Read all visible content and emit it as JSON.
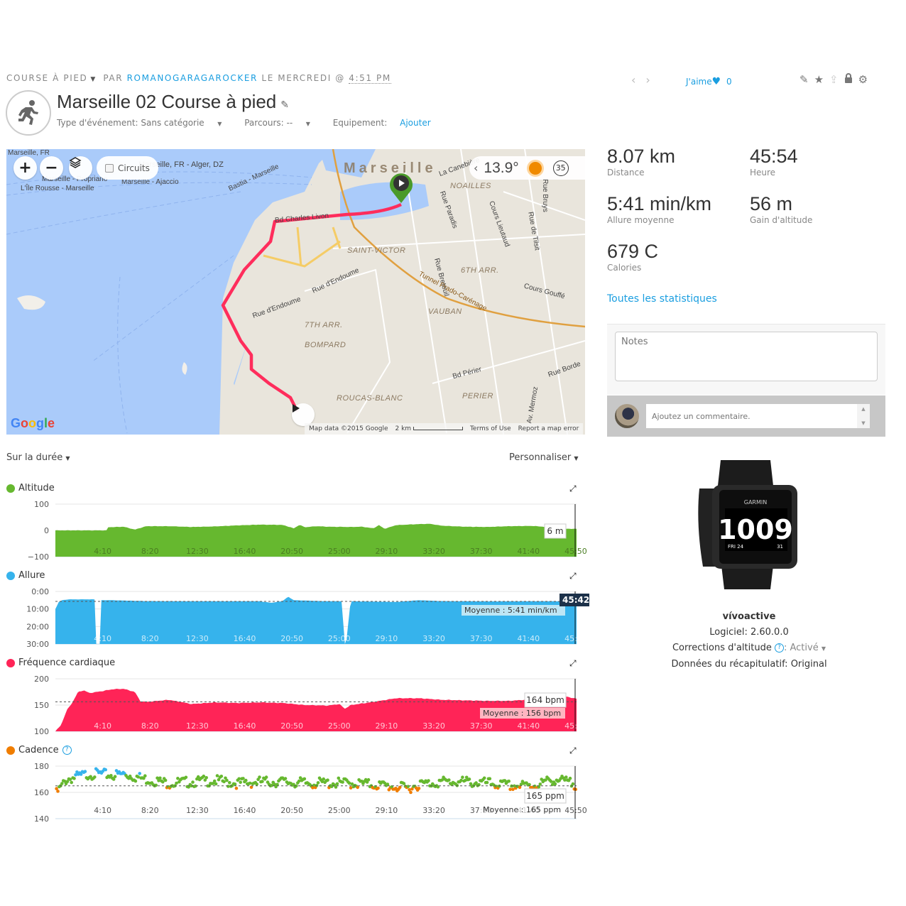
{
  "header": {
    "activity_type": "COURSE À PIED",
    "by_label": "PAR",
    "user": "ROMANOGARAGAROCKER",
    "day_label": "LE MERCREDI @",
    "time": "4:51 PM",
    "title": "Marseille 02 Course à pied",
    "event_type_label": "Type d'événement: Sans catégorie",
    "course_label": "Parcours: --",
    "equipment_label": "Equipement:",
    "equipment_link": "Ajouter",
    "like_label": "J'aime",
    "like_count": "0",
    "icons": [
      "prev-arrow-icon",
      "next-arrow-icon",
      "pencil-icon",
      "star-icon",
      "share-icon",
      "lock-icon",
      "gear-icon"
    ]
  },
  "map": {
    "circuits_label": "Circuits",
    "temperature": "13.9°",
    "wind": "35",
    "labels": {
      "city": "Marseille",
      "ferry1": "Marseille, FR",
      "ferry2": "Marseille, FR - Alger, DZ",
      "ferry3": "Marseille - Propriano",
      "ferry4": "L'Île Rousse - Marseille",
      "ferry5": "Marseille - Ajaccio",
      "ferry6": "Bastia - Marseille",
      "canebiere": "La Canebière",
      "noailles": "NOAILLES",
      "brys": "Rue Bruys",
      "paradis": "Rue Paradis",
      "lieutaud": "Cours Lieutaud",
      "tilsit": "Rue de Tilsit",
      "livon": "Bd Charles Livon",
      "saint_victor": "SAINT-VICTOR",
      "breteuil": "Rue Breteuil",
      "arr6": "6TH ARR.",
      "endoume1": "Rue d'Endoume",
      "endoume2": "Rue d'Endoume",
      "gouffe": "Cours Gouffé",
      "tunnel": "Tunnel Prado-Carénage",
      "vauban": "VAUBAN",
      "arr7": "7TH ARR.",
      "bompard": "BOMPARD",
      "perier_bd": "Bd Périer",
      "rue_borde": "Rue Borde",
      "roucas": "ROUCAS-BLANC",
      "perier": "PERIER",
      "mermoz": "Av. Mermoz"
    },
    "footer": {
      "data": "Map data ©2015 Google",
      "scale": "2 km",
      "terms": "Terms of Use",
      "report": "Report a map error"
    },
    "google": "Google"
  },
  "stats": [
    {
      "value": "8.07 km",
      "label": "Distance"
    },
    {
      "value": "45:54",
      "label": "Heure"
    },
    {
      "value": "5:41 min/km",
      "label": "Allure moyenne"
    },
    {
      "value": "56 m",
      "label": "Gain d'altitude"
    },
    {
      "value": "679 C",
      "label": "Calories"
    }
  ],
  "all_stats_link": "Toutes les statistiques",
  "notes_placeholder": "Notes",
  "comment_placeholder": "Ajoutez un commentaire.",
  "device": {
    "name": "vívoactive",
    "software": "Logiciel: 2.60.0.0",
    "altitude_corr_label": "Corrections d'altitude",
    "altitude_corr_value": ": Activé",
    "summary_data": "Données du récapitulatif: Original",
    "watch_brand": "GARMIN",
    "watch_time": "1009",
    "watch_date": "FRI 24",
    "watch_sec": "31"
  },
  "chart_controls": {
    "x_mode": "Sur la durée",
    "customize": "Personnaliser"
  },
  "chart_data": [
    {
      "type": "area",
      "title": "Altitude",
      "color": "#66b82f",
      "xlabel": "",
      "ylabel": "m",
      "x_ticks": [
        "4:10",
        "8:20",
        "12:30",
        "16:40",
        "20:50",
        "25:00",
        "29:10",
        "33:20",
        "37:30",
        "41:40",
        "45:50"
      ],
      "y_ticks": [
        "100",
        "0",
        "−100"
      ],
      "ylim": [
        -100,
        100
      ],
      "xlim_min": [
        0,
        45.9
      ],
      "x_min": [
        0,
        4.5,
        4.6,
        6,
        7,
        8,
        10,
        12,
        14,
        16,
        18,
        20,
        21,
        21.5,
        22,
        23,
        24,
        26,
        27,
        28,
        28.5,
        29,
        30,
        32,
        33,
        34,
        36,
        38,
        40,
        42,
        43,
        44,
        45.9
      ],
      "values": [
        0,
        0,
        12,
        14,
        3,
        16,
        16,
        13,
        15,
        19,
        22,
        21,
        8,
        21,
        12,
        16,
        14,
        13,
        14,
        8,
        20,
        6,
        20,
        24,
        25,
        18,
        14,
        13,
        16,
        17,
        14,
        6,
        6
      ],
      "tooltip": "6 m"
    },
    {
      "type": "area",
      "title": "Allure",
      "color": "#36b3ec",
      "ylabel": "min/km",
      "y_ticks": [
        "0:00",
        "10:00",
        "20:00",
        "30:00"
      ],
      "ylim_inverted": [
        0,
        30
      ],
      "x_ticks": [
        "4:10",
        "8:20",
        "12:30",
        "16:40",
        "20:50",
        "25:00",
        "29:10",
        "33:20",
        "37:30",
        "41:40",
        "45:50"
      ],
      "x_min": [
        0,
        0.3,
        0.6,
        1.2,
        2,
        3,
        3.5,
        3.6,
        3.9,
        4,
        5,
        8,
        12,
        16,
        18,
        19,
        20,
        20.5,
        21,
        24,
        25.3,
        25.4,
        25.6,
        26,
        28,
        30,
        32,
        34,
        38,
        42,
        45.9
      ],
      "values": [
        10,
        6,
        5,
        4.5,
        4.5,
        4.5,
        4.5,
        30,
        30,
        5,
        5,
        5.5,
        5.6,
        5.6,
        5.6,
        6.5,
        5.5,
        3,
        5,
        5.6,
        5.6,
        30,
        30,
        5.6,
        5.8,
        6,
        5,
        5.5,
        5.7,
        5.6,
        5.6
      ],
      "average_label": "Moyenne : 5:41 min/km",
      "average": 5.68,
      "cursor_label": "45:42"
    },
    {
      "type": "area",
      "title": "Fréquence cardiaque",
      "color": "#ff2457",
      "ylabel": "bpm",
      "y_ticks": [
        "200",
        "150",
        "100"
      ],
      "ylim": [
        100,
        200
      ],
      "x_ticks": [
        "4:10",
        "8:20",
        "12:30",
        "16:40",
        "20:50",
        "25:00",
        "29:10",
        "33:20",
        "37:30",
        "41:40",
        "45:50"
      ],
      "x_min": [
        0,
        0.5,
        1,
        1.5,
        2,
        2.5,
        3,
        4,
        5,
        6,
        7,
        7.5,
        8,
        10,
        12,
        14,
        16,
        18,
        20,
        22,
        24,
        25,
        25.5,
        26,
        28,
        30,
        32,
        34,
        36,
        38,
        40,
        42,
        44,
        45,
        45.9
      ],
      "values": [
        100,
        112,
        140,
        155,
        175,
        178,
        173,
        176,
        180,
        181,
        175,
        157,
        156,
        160,
        152,
        155,
        154,
        155,
        154,
        150,
        149,
        152,
        143,
        150,
        156,
        163,
        163,
        160,
        159,
        158,
        158,
        161,
        158,
        166,
        162
      ],
      "average_label": "Moyenne : 156 bpm",
      "average": 156,
      "tooltip": "164 bpm"
    },
    {
      "type": "scatter",
      "title": "Cadence",
      "color": "#f07d00",
      "ylabel": "ppm",
      "y_ticks": [
        "180",
        "160",
        "140"
      ],
      "ylim": [
        140,
        180
      ],
      "x_ticks": [
        "4:10",
        "8:20",
        "12:30",
        "16:40",
        "20:50",
        "25:00",
        "29:10",
        "33:20",
        "37:30",
        "41:40",
        "45:50"
      ],
      "zone_colors": {
        "high": "#36b3ec",
        "mid": "#66b82f",
        "low": "#f07d00"
      },
      "zone_thresholds": {
        "high_above": 173,
        "low_below": 164
      },
      "sample_every_min": 0.12,
      "trend_min": [
        0,
        0.5,
        1,
        2,
        3,
        4,
        5,
        6,
        7,
        8,
        10,
        12,
        14,
        16,
        18,
        20,
        22,
        24,
        26,
        28,
        30,
        31,
        32,
        34,
        36,
        38,
        40,
        42,
        44,
        45.9
      ],
      "trend_values": [
        158,
        164,
        170,
        172,
        174,
        174,
        173,
        174,
        172,
        170,
        167,
        168,
        169,
        167,
        168,
        168,
        167,
        167,
        167,
        166,
        164,
        163,
        166,
        168,
        168,
        167,
        165,
        165,
        170,
        166
      ],
      "average_label": "Moyenne : 165 ppm",
      "average": 165,
      "tooltip": "165 ppm"
    }
  ]
}
